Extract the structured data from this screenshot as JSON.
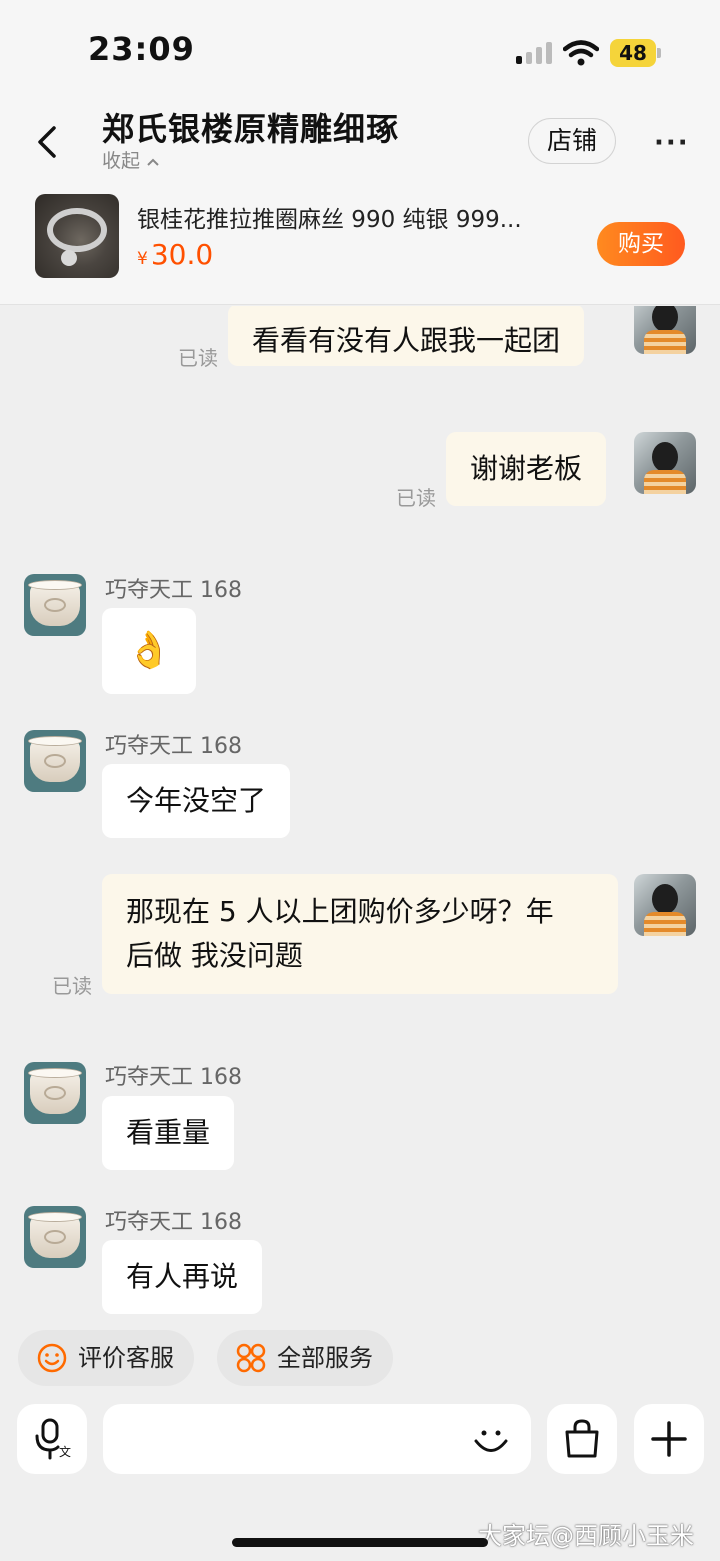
{
  "status_bar": {
    "time": "23:09",
    "battery": "48"
  },
  "header": {
    "shop_name": "郑氏银楼原精雕细琢",
    "collapse_label": "收起",
    "store_button": "店铺",
    "more_label": "···"
  },
  "product": {
    "title": "银桂花推拉推圈麻丝 990 纯银 999...",
    "currency": "¥",
    "price": "30.0",
    "buy_button": "购买"
  },
  "messages": [
    {
      "side": "out",
      "text": "看看有没有人跟我一起团",
      "read": "已读"
    },
    {
      "side": "out",
      "text": "谢谢老板",
      "read": "已读"
    },
    {
      "side": "in",
      "sender": "巧夺天工 168",
      "text": "👌"
    },
    {
      "side": "in",
      "sender": "巧夺天工 168",
      "text": "今年没空了"
    },
    {
      "side": "out",
      "lines": [
        "那现在 5 人以上团购价多少呀？年",
        "后做 我没问题"
      ],
      "read": "已读"
    },
    {
      "side": "in",
      "sender": "巧夺天工 168",
      "text": "看重量"
    },
    {
      "side": "in",
      "sender": "巧夺天工 168",
      "text": "有人再说"
    }
  ],
  "quick_actions": [
    {
      "label": "评价客服",
      "icon": "smile-icon"
    },
    {
      "label": "全部服务",
      "icon": "grid-icon"
    }
  ],
  "input_bar": {
    "voice_icon": "voice-translate-icon",
    "emoji_icon": "emoji-icon",
    "bag_icon": "shopping-bag-icon",
    "plus_icon": "plus-icon"
  },
  "watermark": "大家坛@西顾小玉米",
  "colors": {
    "accent": "#ff5000",
    "out_bubble": "#fcf7ea",
    "in_bubble": "#ffffff",
    "background": "#efefef"
  }
}
